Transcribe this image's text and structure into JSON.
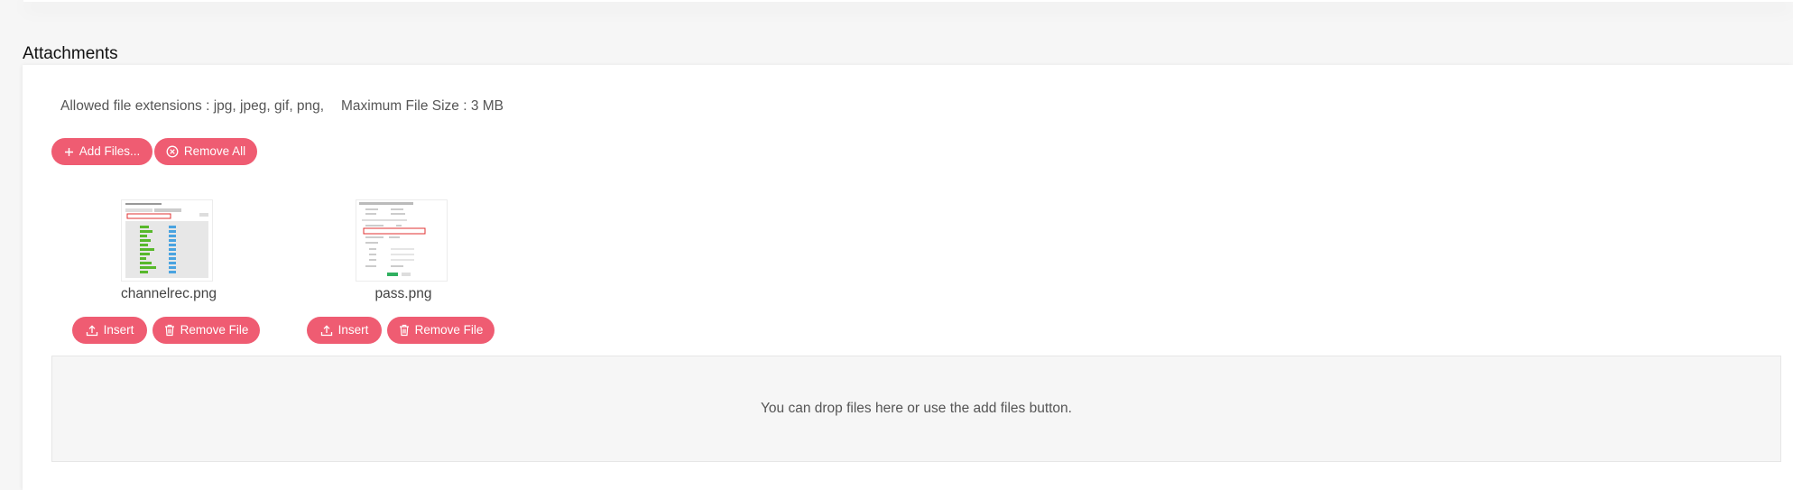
{
  "section": {
    "title": "Attachments"
  },
  "info": {
    "extensions": "Allowed file extensions : jpg, jpeg, gif, png,",
    "max_size": "Maximum File Size : 3 MB"
  },
  "toolbar": {
    "add_files_label": "Add Files...",
    "remove_all_label": "Remove All"
  },
  "files": [
    {
      "name": "channelrec.png",
      "insert_label": "Insert",
      "remove_label": "Remove File"
    },
    {
      "name": "pass.png",
      "insert_label": "Insert",
      "remove_label": "Remove File"
    }
  ],
  "dropzone": {
    "text": "You can drop files here or use the add files button."
  },
  "colors": {
    "accent": "#ef5c72",
    "panel": "#ffffff",
    "background": "#f6f6f6"
  }
}
